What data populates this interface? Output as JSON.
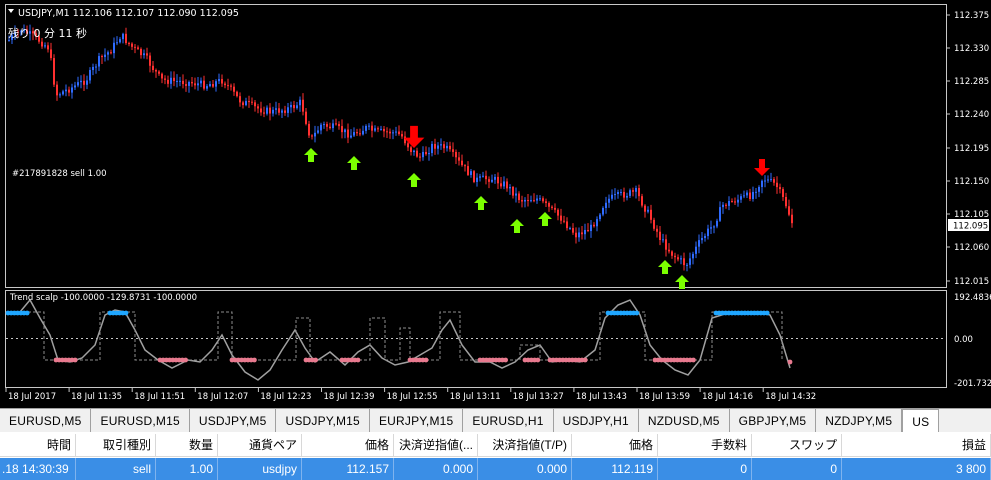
{
  "chart": {
    "title_line": "USDJPY,M1  112.106 112.107 112.090 112.095",
    "countdown": "残り 0 分 11 秒",
    "order_label": "#217891828 sell 1.00",
    "current_price": "112.095",
    "price_labels": [
      "112.375",
      "112.330",
      "112.285",
      "112.240",
      "112.195",
      "112.150",
      "112.105",
      "112.060",
      "112.015"
    ],
    "time_labels": [
      "18 Jul 2017",
      "18 Jul 11:35",
      "18 Jul 11:51",
      "18 Jul 12:07",
      "18 Jul 12:23",
      "18 Jul 12:39",
      "18 Jul 12:55",
      "18 Jul 13:11",
      "18 Jul 13:27",
      "18 Jul 13:43",
      "18 Jul 13:59",
      "18 Jul 14:16",
      "18 Jul 14:32"
    ],
    "indicator_title": "Trend scalp -100.0000 -129.8731 -100.0000",
    "indicator_labels": [
      "192.4836",
      "0.00",
      "-201.7323"
    ],
    "colors": {
      "bull": "#2f6bff",
      "bear": "#ff3030",
      "up_arrow": "#7cff00",
      "down_arrow": "#ff0000",
      "ind_up": "#1fa6ff",
      "ind_down": "#e87a8f",
      "line": "#a0a0a0"
    }
  },
  "tabs": [
    "EURUSD,M5",
    "EURUSD,M15",
    "USDJPY,M5",
    "USDJPY,M15",
    "EURJPY,M15",
    "EURUSD,H1",
    "USDJPY,H1",
    "NZDUSD,M5",
    "GBPJPY,M5",
    "NZDJPY,M5",
    "US"
  ],
  "terminal": {
    "headers": [
      "時間",
      "取引種別",
      "数量",
      "通貨ペア",
      "価格",
      "決済逆指値(...",
      "決済指値(T/P)",
      "価格",
      "手数料",
      "スワップ",
      "損益"
    ],
    "row": [
      ".18 14:30:39",
      "sell",
      "1.00",
      "usdjpy",
      "112.157",
      "0.000",
      "0.000",
      "112.119",
      "0",
      "0",
      "3 800"
    ]
  }
}
